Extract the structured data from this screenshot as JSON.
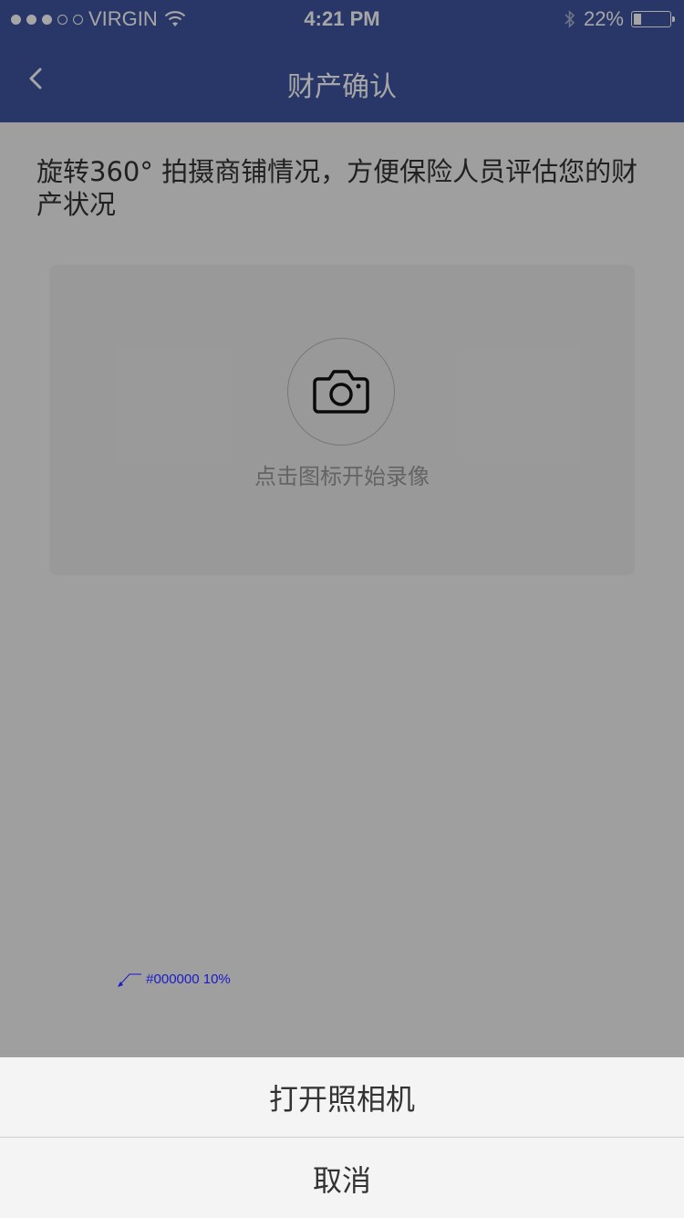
{
  "status_bar": {
    "carrier": "VIRGIN",
    "time": "4:21 PM",
    "battery": "22%",
    "battery_level": 0.22
  },
  "nav": {
    "title": "财产确认",
    "back_icon": "chevron-left-icon"
  },
  "content": {
    "description": "旋转360° 拍摄商铺情况，方便保险人员评估您的财产状况",
    "camera_icon": "camera-icon",
    "hint": "点击图标开始录像"
  },
  "annotations": {
    "overlay_note": "#000000 10%",
    "dialog_note": "std_dialog3"
  },
  "sheet": {
    "open_camera": "打开照相机",
    "cancel": "取消"
  },
  "colors": {
    "brand": "#3f55a0",
    "annotation": "#1a1acc"
  }
}
